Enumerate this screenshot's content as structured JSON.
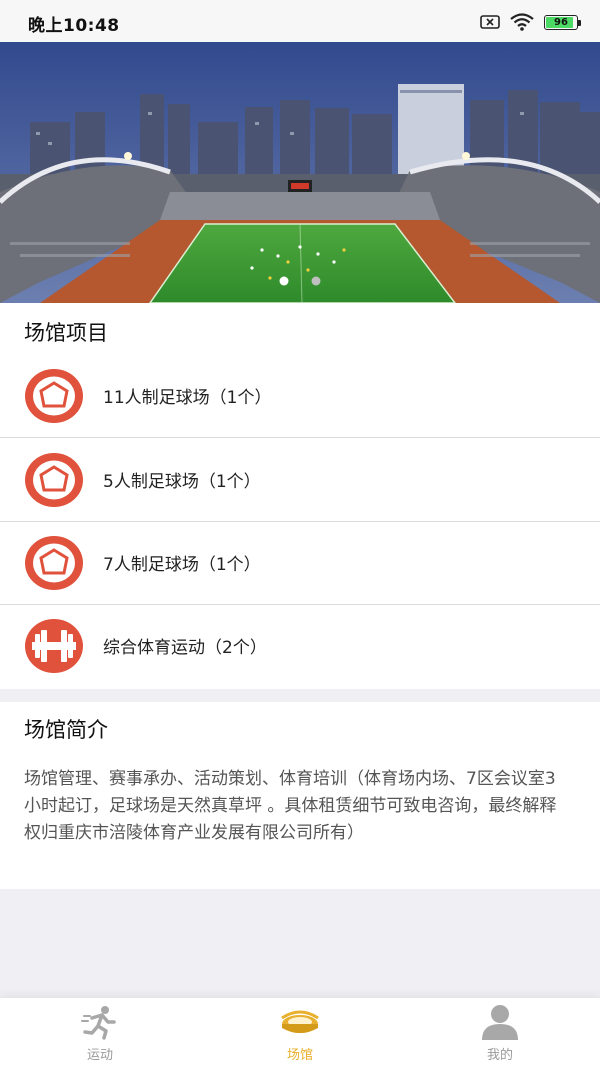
{
  "status_bar": {
    "time": "晚上10:48",
    "battery": "96",
    "icons": [
      "sim-off-icon",
      "wifi-icon",
      "battery-icon"
    ]
  },
  "banner": {
    "page_count": 2,
    "active_page": 1
  },
  "venue_projects": {
    "title": "场馆项目",
    "items": [
      {
        "label": "11人制足球场（1个）",
        "icon": "football-icon"
      },
      {
        "label": "5人制足球场（1个）",
        "icon": "football-icon"
      },
      {
        "label": "7人制足球场（1个）",
        "icon": "football-icon"
      },
      {
        "label": "综合体育运动（2个）",
        "icon": "dumbbell-icon"
      }
    ]
  },
  "venue_intro": {
    "title": "场馆简介",
    "text": "场馆管理、赛事承办、活动策划、体育培训（体育场内场、7区会议室3小时起订，足球场是天然真草坪 。具体租赁细节可致电咨询，最终解释权归重庆市涪陵体育产业发展有限公司所有）"
  },
  "tabbar": {
    "tabs": [
      {
        "label": "运动",
        "icon": "running-icon",
        "active": false
      },
      {
        "label": "场馆",
        "icon": "stadium-icon",
        "active": true
      },
      {
        "label": "我的",
        "icon": "user-icon",
        "active": false
      }
    ]
  },
  "colors": {
    "accent": "#e8b02c",
    "icon_red": "#e0523c",
    "inactive": "#9a9a9a"
  }
}
